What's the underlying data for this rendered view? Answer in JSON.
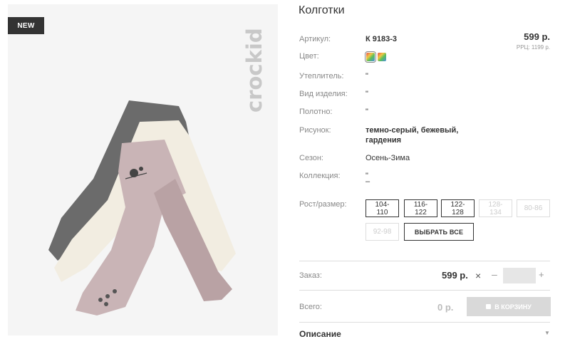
{
  "badge": "NEW",
  "brand": "crockid",
  "product": {
    "title": "Колготки",
    "price": "599 р.",
    "rrp": "РРЦ: 1199 р."
  },
  "specs": {
    "article_label": "Артикул:",
    "article_value": "К 9183-3",
    "color_label": "Цвет:",
    "insulation_label": "Утеплитель:",
    "insulation_value": "\"",
    "type_label": "Вид изделия:",
    "type_value": "\"",
    "fabric_label": "Полотно:",
    "fabric_value": "\"",
    "pattern_label": "Рисунок:",
    "pattern_value_line1": "темно-серый, бежевый,",
    "pattern_value_line2": "гардения",
    "season_label": "Сезон:",
    "season_value": "Осень-Зима",
    "collection_label": "Коллекция:",
    "collection_value": "\"",
    "collection_value2": "–"
  },
  "sizes": {
    "label": "Рост/размер:",
    "items": [
      {
        "label": "104-110",
        "available": true
      },
      {
        "label": "116-122",
        "available": true
      },
      {
        "label": "122-128",
        "available": true
      },
      {
        "label": "128-134",
        "available": false
      },
      {
        "label": "80-86",
        "available": false
      },
      {
        "label": "92-98",
        "available": false
      }
    ],
    "select_all": "ВЫБРАТЬ ВСЕ"
  },
  "order": {
    "label": "Заказ:",
    "price": "599 р.",
    "times": "×",
    "minus": "–",
    "plus": "+",
    "quantity": ""
  },
  "total": {
    "label": "Всего:",
    "value": "0 р.",
    "cart_button": "В КОРЗИНУ"
  },
  "description": {
    "label": "Описание",
    "icon": "chevron-down-icon"
  },
  "icons": {
    "swatches": [
      "color-swatch-icon",
      "color-swatch-icon"
    ]
  }
}
